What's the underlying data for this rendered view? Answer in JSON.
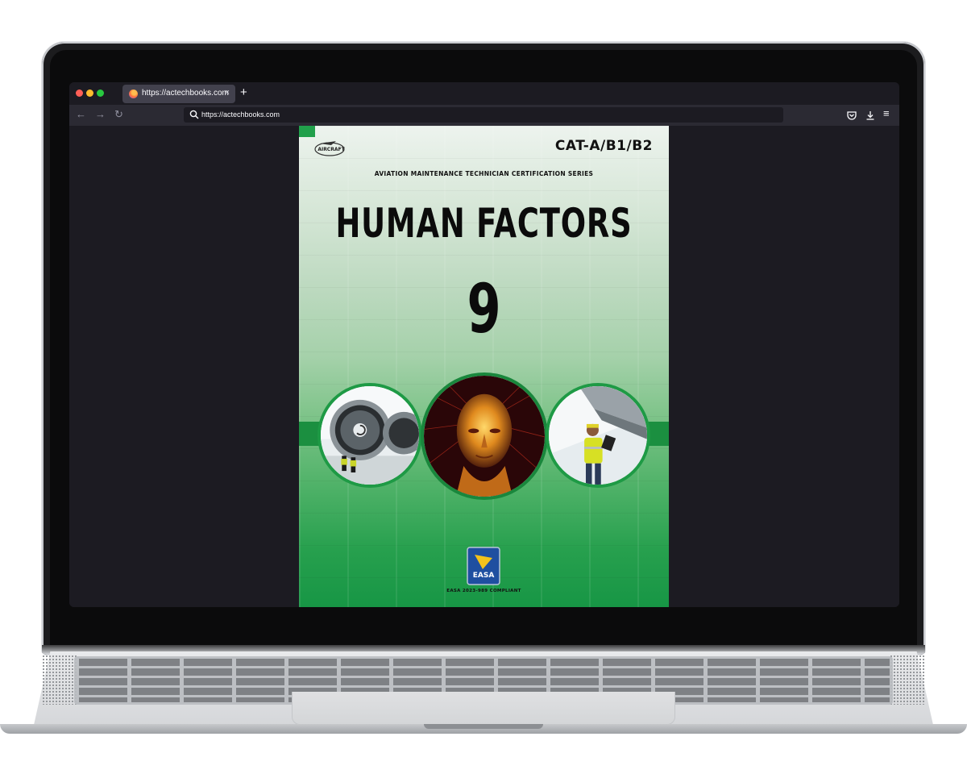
{
  "browser": {
    "tab_title": "https://actechbooks.com",
    "tab_close": "×",
    "new_tab": "+",
    "url": "https://actechbooks.com",
    "nav": {
      "back": "←",
      "forward": "→",
      "reload": "↻"
    },
    "menu": "≡"
  },
  "book": {
    "category": "CAT-A/B1/B2",
    "series": "AVIATION MAINTENANCE TECHNICIAN CERTIFICATION SERIES",
    "title": "HUMAN FACTORS",
    "module_number": "9",
    "compliance": "EASA 2023-989 COMPLIANT",
    "accent_color": "#1e9a45",
    "logo_text": "AIRCRAFT",
    "badge_text": "EASA"
  }
}
